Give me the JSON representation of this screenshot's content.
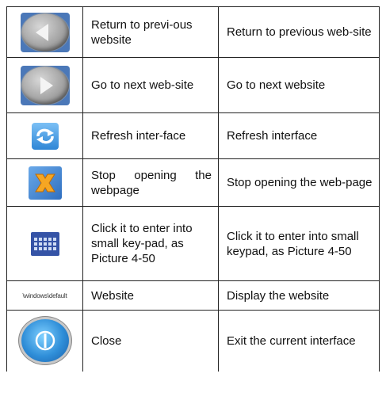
{
  "rows": [
    {
      "icon": "back-arrow-icon",
      "name": "Return to previ-ous website",
      "desc": "Return to previous web-site"
    },
    {
      "icon": "forward-arrow-icon",
      "name": "Go to next web-site",
      "desc": "Go to next website"
    },
    {
      "icon": "refresh-icon",
      "name": "Refresh inter-face",
      "desc": "Refresh interface"
    },
    {
      "icon": "stop-icon",
      "name": "Stop opening the webpage",
      "desc": "Stop opening the web-page"
    },
    {
      "icon": "keypad-icon",
      "name": "Click it to enter into small key-pad, as Picture 4-50",
      "desc": "Click it to enter into small keypad, as Picture 4-50"
    },
    {
      "icon": "path-text",
      "path": "\\windows\\default",
      "name": "Website",
      "desc": "Display the website"
    },
    {
      "icon": "power-icon",
      "name": "Close",
      "desc": "Exit the current interface"
    }
  ],
  "colors": {
    "border": "#222222",
    "icon_blue": "#2f8ed8",
    "stop_orange": "#f5a623"
  }
}
